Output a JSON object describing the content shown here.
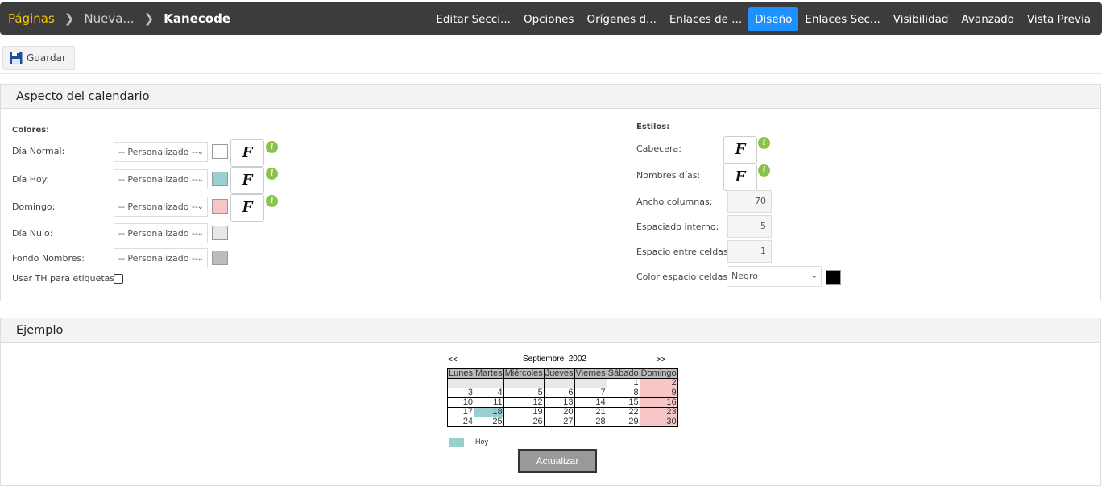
{
  "breadcrumb": {
    "home": "Páginas",
    "item1": "Nueva...",
    "current": "Kanecode"
  },
  "tabs": [
    "Editar Secci...",
    "Opciones",
    "Orígenes d...",
    "Enlaces de ...",
    "Diseño",
    "Enlaces Sec...",
    "Visibilidad",
    "Avanzado",
    "Vista Previa"
  ],
  "active_tab": "Diseño",
  "toolbar": {
    "save_label": "Guardar"
  },
  "panel1": {
    "title": "Aspecto del calendario",
    "colores_label": "Colores:",
    "rows": [
      {
        "label": "Día Normal:",
        "select": "-- Personalizado --",
        "color": "#ffffff"
      },
      {
        "label": "Día Hoy:",
        "select": "-- Personalizado --",
        "color": "#98cfcf"
      },
      {
        "label": "Domingo:",
        "select": "-- Personalizado --",
        "color": "#f7c6c6"
      },
      {
        "label": "Día Nulo:",
        "select": "-- Personalizado --",
        "color": "#e8e8e8"
      },
      {
        "label": "Fondo Nombres:",
        "select": "-- Personalizado --",
        "color": "#bbbbbb"
      }
    ],
    "th_label": "Usar TH para etiquetas:",
    "estilos_label": "Estilos:",
    "cabecera": "Cabecera:",
    "nombres_dias": "Nombres días:",
    "ancho_label": "Ancho columnas:",
    "ancho_value": "70",
    "espaciado_label": "Espaciado interno:",
    "espaciado_value": "5",
    "espacio_label": "Espacio entre celdas:",
    "espacio_value": "1",
    "color_espacio_label": "Color espacio celdas:",
    "color_espacio_value": "Negro",
    "font_glyph": "F",
    "info_glyph": "i"
  },
  "panel2": {
    "title": "Ejemplo",
    "prev": "<<",
    "next": ">>",
    "month": "Septiembre, 2002",
    "days": [
      "Lunes",
      "Martes",
      "Miércoles",
      "Jueves",
      "Viernes",
      "Sábado",
      "Domingo"
    ],
    "weeks": [
      [
        "",
        "",
        "",
        "",
        "",
        "1",
        "2"
      ],
      [
        "3",
        "4",
        "5",
        "6",
        "7",
        "8",
        "9"
      ],
      [
        "10",
        "11",
        "12",
        "13",
        "14",
        "15",
        "16"
      ],
      [
        "17",
        "18",
        "19",
        "20",
        "21",
        "22",
        "23"
      ],
      [
        "24",
        "25",
        "26",
        "27",
        "28",
        "29",
        "30"
      ]
    ],
    "today": "18",
    "legend": "Hoy",
    "update_label": "Actualizar"
  }
}
